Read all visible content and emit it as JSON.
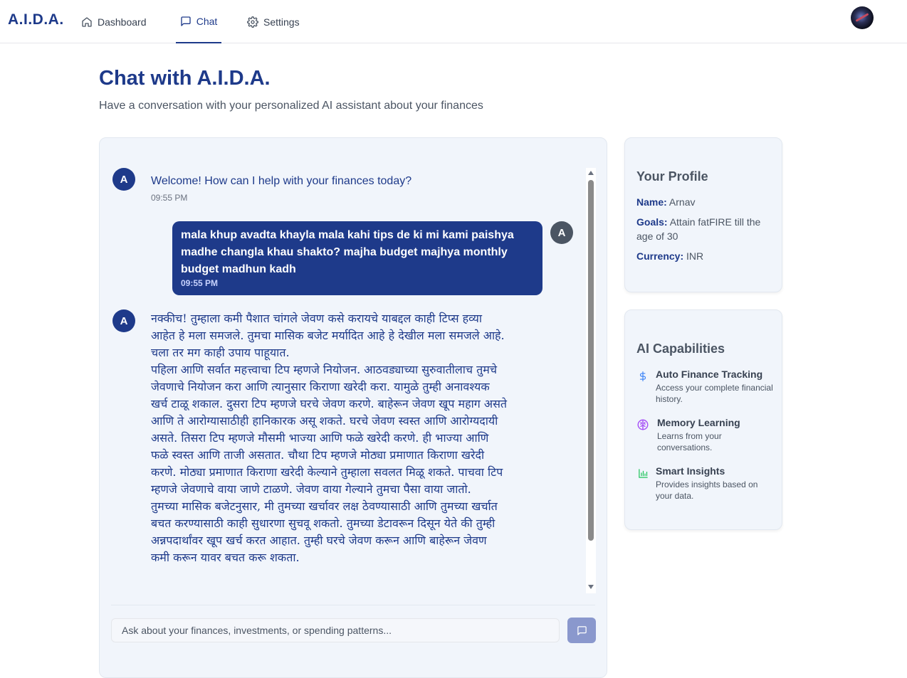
{
  "nav": {
    "brand": "A.I.D.A.",
    "items": [
      {
        "label": "Dashboard",
        "icon": "home-icon"
      },
      {
        "label": "Chat",
        "icon": "chat-bubble-icon",
        "active": true
      },
      {
        "label": "Settings",
        "icon": "gear-icon"
      }
    ],
    "avatar": "user-avatar"
  },
  "header": {
    "title": "Chat with A.I.D.A.",
    "subtitle": "Have a conversation with your personalized AI assistant about your finances"
  },
  "chat": {
    "messages": [
      {
        "sender": "ai",
        "avatar": "A",
        "text": "Welcome! How can I help with your finances today?",
        "time": "09:55 PM"
      },
      {
        "sender": "user",
        "avatar": "A",
        "text": "mala khup avadta khayla mala kahi tips de ki mi kami paishya madhe changla khau shakto? majha budget majhya monthly budget madhun kadh",
        "time": "09:55 PM"
      },
      {
        "sender": "ai",
        "avatar": "A",
        "paragraphs": [
          "नक्कीच! तुम्हाला कमी पैशात चांगले जेवण कसे करायचे याबद्दल काही टिप्स हव्या आहेत हे मला समजले. तुमचा मासिक बजेट मर्यादित आहे हे देखील मला समजले आहे. चला तर मग काही उपाय पाहूयात.",
          "पहिला आणि सर्वात महत्त्वाचा टिप म्हणजे नियोजन. आठवड्याच्या सुरुवातीलाच तुमचे जेवणाचे नियोजन करा आणि त्यानुसार किराणा खरेदी करा. यामुळे तुम्ही अनावश्यक खर्च टाळू शकाल.  दुसरा टिप म्हणजे घरचे जेवण करणे. बाहेरून जेवण खूप महाग असते आणि ते आरोग्यासाठीही हानिकारक असू शकते. घरचे जेवण स्वस्त आणि आरोग्यदायी असते. तिसरा टिप म्हणजे मौसमी भाज्या आणि फळे खरेदी करणे. ही भाज्या आणि फळे स्वस्त आणि ताजी असतात. चौथा टिप म्हणजे मोठ्या प्रमाणात किराणा खरेदी करणे. मोठ्या प्रमाणात किराणा खरेदी केल्याने तुम्हाला सवलत मिळू शकते. पाचवा टिप म्हणजे जेवणाचे वाया जाणे टाळणे. जेवण वाया गेल्याने तुमचा पैसा वाया जातो.",
          "तुमच्या मासिक बजेटनुसार, मी तुमच्या खर्चावर लक्ष ठेवण्यासाठी आणि तुमच्या खर्चात बचत करण्यासाठी काही सुधारणा सुचवू शकतो.  तुमच्या डेटावरून दिसून येते की तुम्ही अन्नपदार्थांवर खूप खर्च करत आहात.  तुम्ही घरचे जेवण करून आणि बाहेरून जेवण कमी करून यावर बचत करू शकता."
        ]
      }
    ],
    "input_placeholder": "Ask about your finances, investments, or spending patterns...",
    "send_icon": "send-message-icon"
  },
  "profile": {
    "title": "Your Profile",
    "name_label": "Name:",
    "name_value": "Arnav",
    "goals_label": "Goals:",
    "goals_value": "Attain fatFIRE till the age of 30",
    "currency_label": "Currency:",
    "currency_value": "INR"
  },
  "capabilities": {
    "title": "AI Capabilities",
    "items": [
      {
        "name": "Auto Finance Tracking",
        "desc": "Access your complete financial history.",
        "icon": "dollar-icon",
        "color": "#3b82f6"
      },
      {
        "name": "Memory Learning",
        "desc": "Learns from your conversations.",
        "icon": "brain-icon",
        "color": "#a855f7"
      },
      {
        "name": "Smart Insights",
        "desc": "Provides insights based on your data.",
        "icon": "bar-chart-icon",
        "color": "#22c55e"
      }
    ]
  }
}
